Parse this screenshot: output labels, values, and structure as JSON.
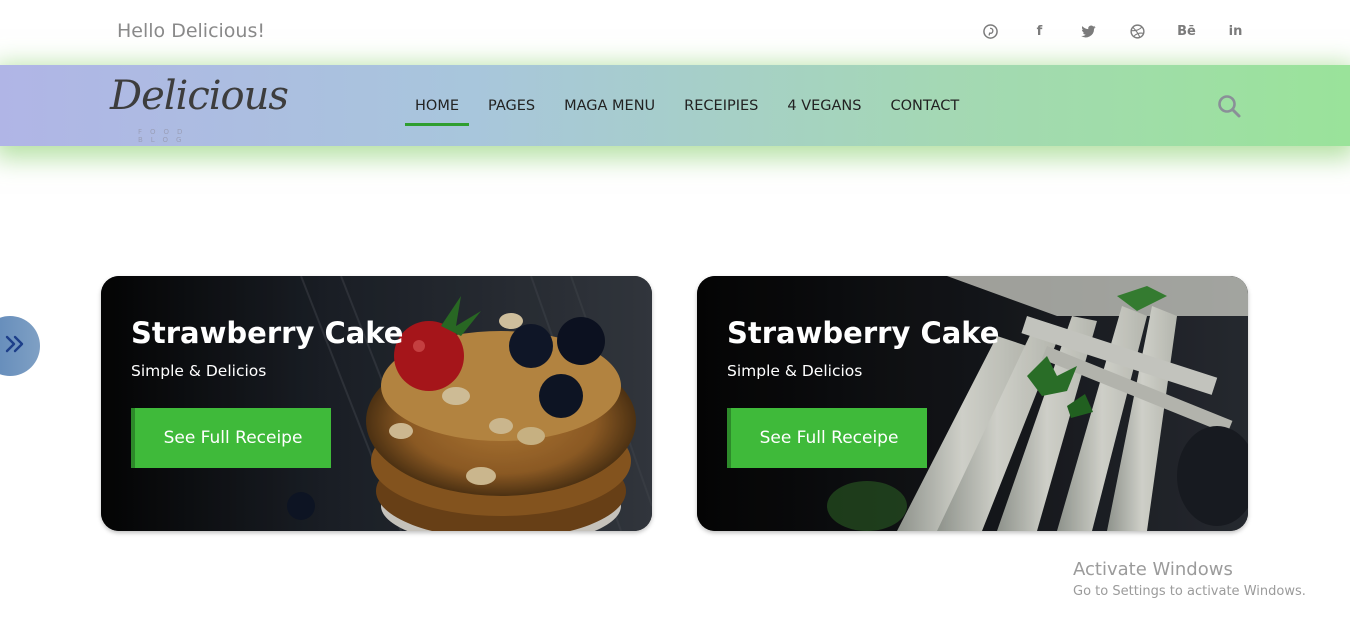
{
  "topbar": {
    "greeting": "Hello Delicious!",
    "social": [
      {
        "icon": "pinterest-icon",
        "glyph": ""
      },
      {
        "icon": "facebook-icon",
        "glyph": "f"
      },
      {
        "icon": "twitter-icon",
        "glyph": ""
      },
      {
        "icon": "dribbble-icon",
        "glyph": ""
      },
      {
        "icon": "behance-icon",
        "glyph": "Bē"
      },
      {
        "icon": "linkedin-icon",
        "glyph": "in"
      }
    ]
  },
  "logo": {
    "name": "Delicious",
    "tagline": "FOOD BLOG"
  },
  "nav": {
    "items": [
      "HOME",
      "PAGES",
      "MAGA MENU",
      "RECEIPIES",
      "4 VEGANS",
      "CONTACT"
    ],
    "active": "HOME",
    "search_icon": "search-icon"
  },
  "cards": [
    {
      "title": "Strawberry Cake",
      "subtitle": "Simple & Delicios",
      "button": "See Full Receipe"
    },
    {
      "title": "Strawberry Cake",
      "subtitle": "Simple & Delicios",
      "button": "See Full Receipe"
    }
  ],
  "side_toggle": {
    "icon": "double-chevron-right-icon"
  },
  "watermark": {
    "title": "Activate Windows",
    "subtitle": "Go to Settings to activate Windows."
  },
  "colors": {
    "accent_green": "#3fba3a",
    "nav_active_underline": "#2f9e2f",
    "nav_gradient_start": "#b0b5e6",
    "nav_gradient_end": "#9ae39a"
  }
}
